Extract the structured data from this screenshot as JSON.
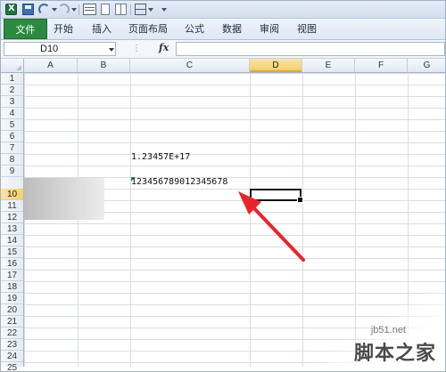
{
  "quick_access": {
    "icons": [
      "excel-icon",
      "save-icon",
      "undo-icon",
      "redo-icon",
      "table-icon",
      "new-doc-icon",
      "grid-icon",
      "borders-icon"
    ]
  },
  "ribbon": {
    "tabs": [
      {
        "label": "文件",
        "active": true
      },
      {
        "label": "开始"
      },
      {
        "label": "插入"
      },
      {
        "label": "页面布局"
      },
      {
        "label": "公式"
      },
      {
        "label": "数据"
      },
      {
        "label": "审阅"
      },
      {
        "label": "视图"
      }
    ],
    "file_tab_color": "#2c8a3e"
  },
  "formula_bar": {
    "name_box": "D10",
    "fx_label": "fx",
    "formula": ""
  },
  "grid": {
    "columns": [
      "A",
      "B",
      "C",
      "D",
      "E",
      "F",
      "G"
    ],
    "active_column": "D",
    "rows": [
      "1",
      "2",
      "3",
      "4",
      "5",
      "6",
      "7",
      "8",
      "9",
      "10",
      "11",
      "12",
      "13",
      "14",
      "15",
      "16",
      "17",
      "18",
      "19",
      "20",
      "21",
      "22",
      "23",
      "24",
      "25"
    ],
    "active_row": "10",
    "cells": {
      "C7": "1.23457E+17",
      "C9": "123456789012345678"
    },
    "selected_cell": "D10"
  },
  "watermark": {
    "url": "jb51.net",
    "name": "脚本之家"
  },
  "colors": {
    "arrow": "#e8262a",
    "selection_border": "#111111",
    "header_highlight": "#f3cf6e"
  }
}
